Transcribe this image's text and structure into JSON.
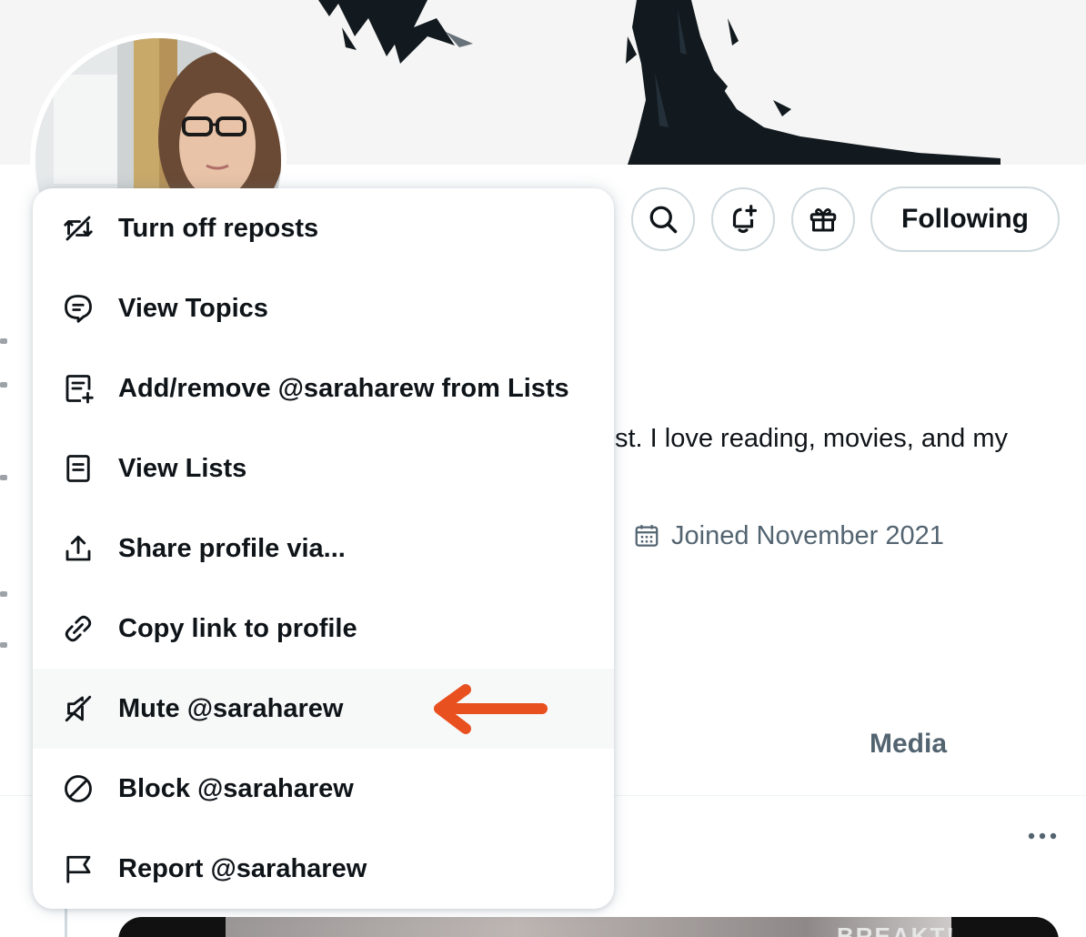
{
  "profile": {
    "bio_fragment": "st. I love reading, movies, and my",
    "joined": "Joined November 2021"
  },
  "actions": {
    "following_label": "Following"
  },
  "tabs": {
    "media_label": "Media"
  },
  "menu": {
    "items": [
      {
        "label": "Turn off reposts",
        "icon": "repost-off-icon"
      },
      {
        "label": "View Topics",
        "icon": "topics-icon"
      },
      {
        "label": "Add/remove @saraharew from Lists",
        "icon": "list-add-icon"
      },
      {
        "label": "View Lists",
        "icon": "list-icon"
      },
      {
        "label": "Share profile via...",
        "icon": "share-icon"
      },
      {
        "label": "Copy link to profile",
        "icon": "link-icon"
      },
      {
        "label": "Mute @saraharew",
        "icon": "mute-icon"
      },
      {
        "label": "Block @saraharew",
        "icon": "block-icon"
      },
      {
        "label": "Report @saraharew",
        "icon": "flag-icon"
      }
    ],
    "highlighted_index": 6
  },
  "tweet": {
    "media_caption": "BREAKT!"
  },
  "colors": {
    "text_primary": "#0f1419",
    "text_secondary": "#536471",
    "border": "#cfd9de",
    "hover_bg": "#f7f9f9",
    "annotation_arrow": "#e8501f"
  }
}
